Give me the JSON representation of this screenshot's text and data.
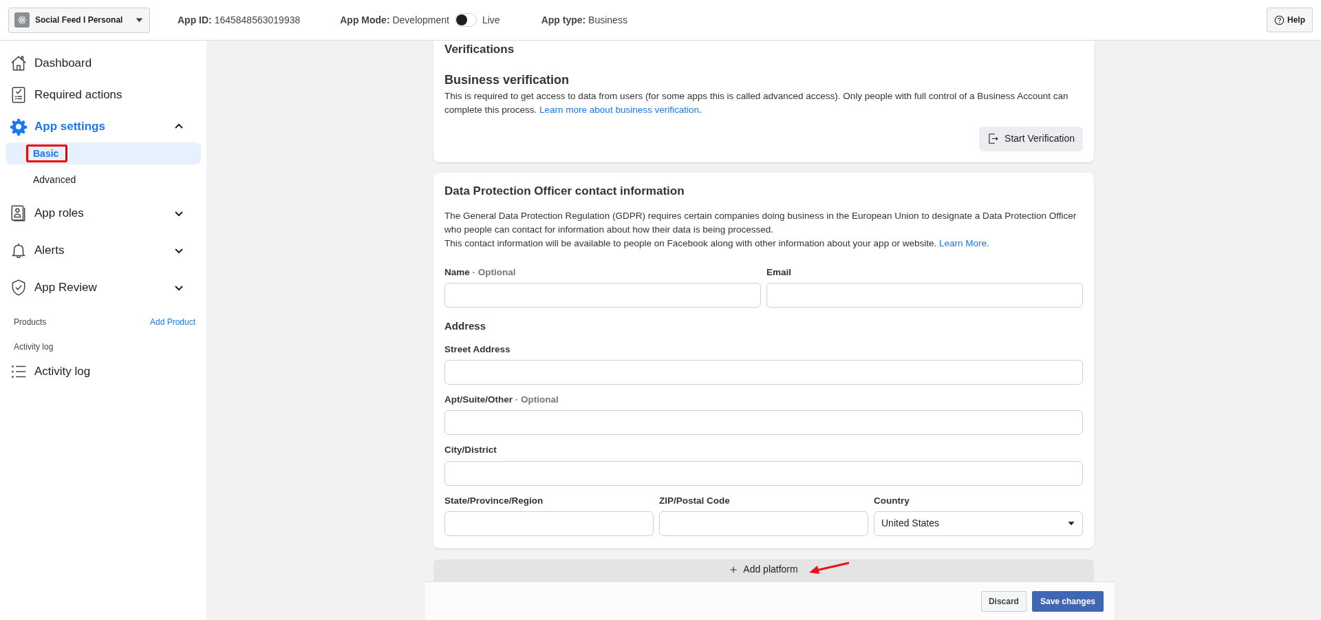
{
  "topbar": {
    "app_name": "Social Feed I Personal",
    "app_id_label": "App ID:",
    "app_id": "1645848563019938",
    "mode_label": "App Mode:",
    "mode_left": "Development",
    "mode_live": false,
    "mode_right": "Live",
    "type_label": "App type:",
    "type": "Business",
    "help": "Help"
  },
  "sidebar": {
    "items": [
      {
        "label": "Dashboard",
        "kind": "link",
        "selected": false
      },
      {
        "label": "Required actions",
        "kind": "link",
        "selected": false
      },
      {
        "label": "App settings",
        "kind": "group",
        "selected": true,
        "expanded": true,
        "children": [
          {
            "label": "Basic",
            "selected": true,
            "highlighted": true
          },
          {
            "label": "Advanced",
            "selected": false,
            "highlighted": false
          }
        ]
      },
      {
        "label": "App roles",
        "kind": "group",
        "selected": false,
        "expanded": false
      },
      {
        "label": "Alerts",
        "kind": "group",
        "selected": false,
        "expanded": false
      },
      {
        "label": "App Review",
        "kind": "group",
        "selected": false,
        "expanded": false
      }
    ],
    "products_label": "Products",
    "add_product": "Add Product",
    "activity_heading": "Activity log",
    "activity_item": {
      "label": "Activity log"
    }
  },
  "verifications": {
    "heading": "Verifications",
    "subheading": "Business verification",
    "text": "This is required to get access to data from users (for some apps this is called advanced access). Only people with full control of a Business Account can complete this process. ",
    "link": "Learn more about business verification",
    "after_link": ".",
    "button": "Start Verification"
  },
  "dpo": {
    "title": "Data Protection Officer contact information",
    "paragraphs": [
      {
        "text": "The General Data Protection Regulation (GDPR) requires certain companies doing business in the European Union to designate a Data Protection Officer who people can contact for information about how their data is being processed."
      },
      {
        "text": "This contact information will be available to people on Facebook along with other information about your app or website. ",
        "link": "Learn More."
      }
    ],
    "rows": [
      [
        {
          "label": "Name",
          "optional": "· Optional",
          "kind": "text"
        },
        {
          "label": "Email",
          "kind": "text"
        }
      ],
      {
        "heading": "Address"
      },
      [
        {
          "label": "Street Address",
          "kind": "text"
        }
      ],
      [
        {
          "label": "Apt/Suite/Other",
          "optional": "· Optional",
          "kind": "text"
        }
      ],
      [
        {
          "label": "City/District",
          "kind": "text"
        }
      ],
      [
        {
          "label": "State/Province/Region",
          "kind": "text"
        },
        {
          "label": "ZIP/Postal Code",
          "kind": "text"
        },
        {
          "label": "Country",
          "kind": "select",
          "value": "United States"
        }
      ]
    ]
  },
  "add_platform": {
    "label": "Add platform",
    "arrow": true
  },
  "footer": {
    "discard": "Discard",
    "save": "Save changes"
  }
}
